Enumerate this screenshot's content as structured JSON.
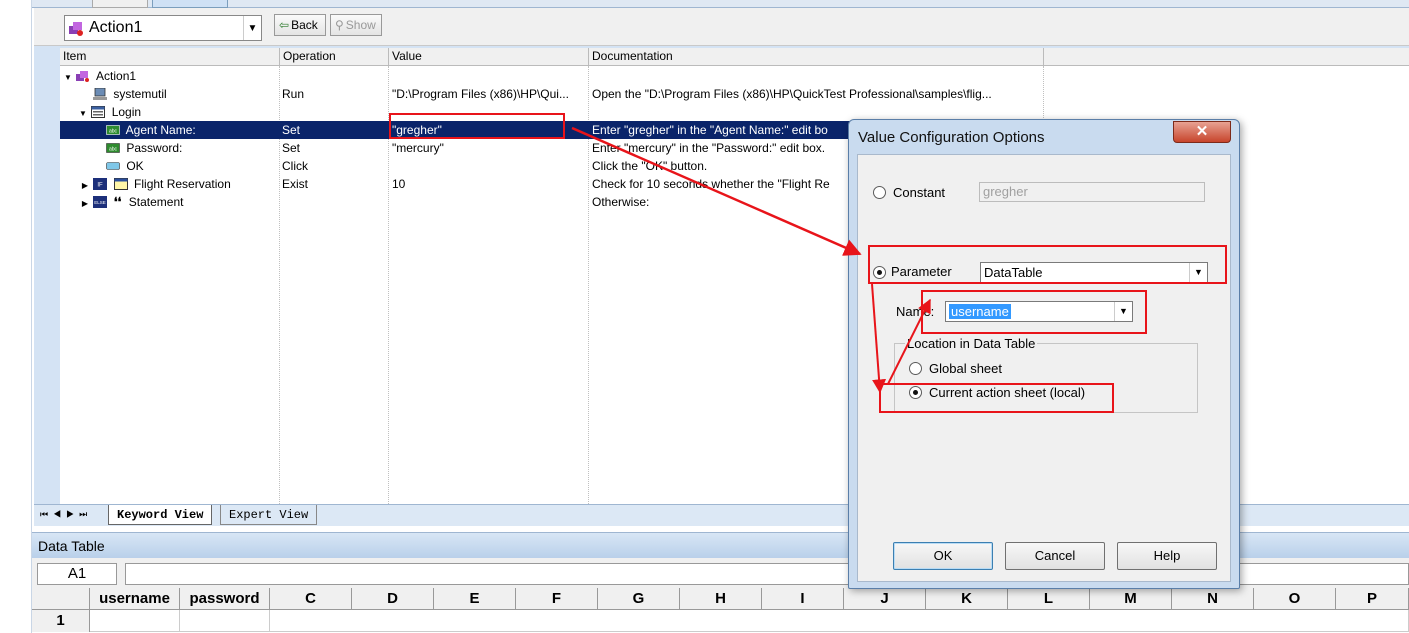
{
  "toolbar": {
    "action_combo_value": "Action1",
    "back_label": "Back",
    "show_label": "Show"
  },
  "grid": {
    "columns": [
      "Item",
      "Operation",
      "Value",
      "Documentation"
    ],
    "rows": [
      {
        "item": "Action1",
        "operation": "",
        "value": "",
        "doc": ""
      },
      {
        "item": "systemutil",
        "operation": "Run",
        "value": "\"D:\\Program Files (x86)\\HP\\Qui...",
        "doc": "Open the \"D:\\Program Files (x86)\\HP\\QuickTest Professional\\samples\\flig..."
      },
      {
        "item": "Login",
        "operation": "",
        "value": "",
        "doc": ""
      },
      {
        "item": "Agent Name:",
        "operation": "Set",
        "value": "\"gregher\"",
        "doc": "Enter \"gregher\" in the \"Agent Name:\" edit bo"
      },
      {
        "item": "Password:",
        "operation": "Set",
        "value": "\"mercury\"",
        "doc": "Enter \"mercury\" in the \"Password:\" edit box."
      },
      {
        "item": "OK",
        "operation": "Click",
        "value": "",
        "doc": "Click the \"OK\" button."
      },
      {
        "item": "Flight Reservation",
        "operation": "Exist",
        "value": "10",
        "doc": "Check for 10 seconds whether the \"Flight Re"
      },
      {
        "item": "Statement",
        "operation": "",
        "value": "",
        "doc": "Otherwise:"
      }
    ]
  },
  "view_tabs": {
    "keyword": "Keyword View",
    "expert": "Expert View"
  },
  "data_table": {
    "title": "Data Table",
    "cell_ref": "A1",
    "columns": [
      "username",
      "password",
      "C",
      "D",
      "E",
      "F",
      "G",
      "H",
      "I",
      "J",
      "K",
      "L",
      "M",
      "N",
      "O",
      "P"
    ],
    "row_number": "1"
  },
  "dialog": {
    "title": "Value Configuration Options",
    "close_glyph": "✕",
    "constant_label": "Constant",
    "constant_value": "gregher",
    "parameter_label": "Parameter",
    "parameter_type": "DataTable",
    "name_label": "Name:",
    "name_value": "username",
    "location_legend": "Location in Data Table",
    "global_label": "Global sheet",
    "current_label": "Current action sheet (local)",
    "ok_label": "OK",
    "cancel_label": "Cancel",
    "help_label": "Help",
    "selected_option": "parameter",
    "selected_location": "current"
  },
  "annotation_color": "#e8141a"
}
